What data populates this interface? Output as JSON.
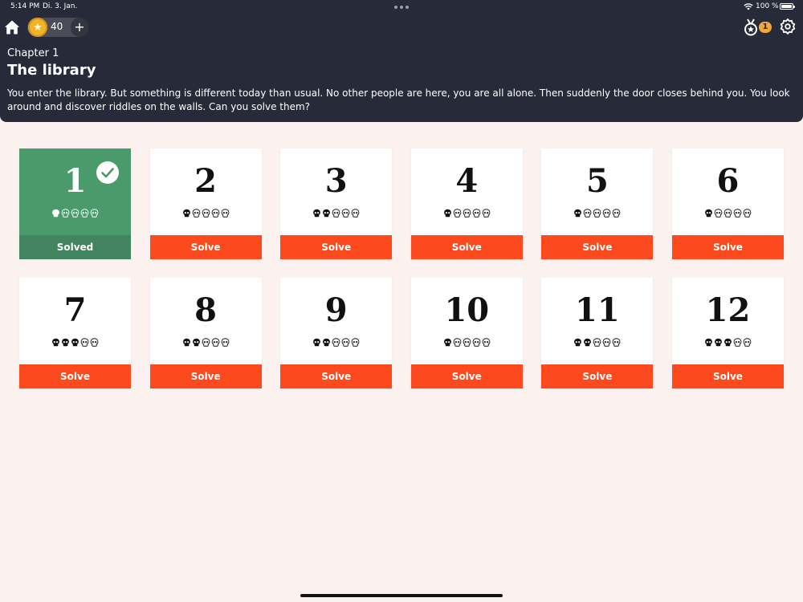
{
  "status_bar": {
    "time": "5:14 PM",
    "date": "Di. 3. Jan.",
    "battery": "100 %"
  },
  "toolbar": {
    "coins": "40",
    "add_label": "+",
    "medal_count": "1"
  },
  "chapter": {
    "label": "Chapter 1",
    "title": "The library",
    "description": "You enter the library. But something is different today than usual. No other people are here, you are all alone. Then suddenly the door closes behind you. You look around and discover riddles on the walls. Can you solve them?"
  },
  "riddles": [
    {
      "number": "1",
      "difficulty": 1,
      "status": "Solved",
      "solved": true
    },
    {
      "number": "2",
      "difficulty": 1,
      "status": "Solve",
      "solved": false
    },
    {
      "number": "3",
      "difficulty": 2,
      "status": "Solve",
      "solved": false
    },
    {
      "number": "4",
      "difficulty": 1,
      "status": "Solve",
      "solved": false
    },
    {
      "number": "5",
      "difficulty": 1,
      "status": "Solve",
      "solved": false
    },
    {
      "number": "6",
      "difficulty": 1,
      "status": "Solve",
      "solved": false
    },
    {
      "number": "7",
      "difficulty": 3,
      "status": "Solve",
      "solved": false
    },
    {
      "number": "8",
      "difficulty": 2,
      "status": "Solve",
      "solved": false
    },
    {
      "number": "9",
      "difficulty": 2,
      "status": "Solve",
      "solved": false
    },
    {
      "number": "10",
      "difficulty": 1,
      "status": "Solve",
      "solved": false
    },
    {
      "number": "11",
      "difficulty": 2,
      "status": "Solve",
      "solved": false
    },
    {
      "number": "12",
      "difficulty": 3,
      "status": "Solve",
      "solved": false
    }
  ],
  "difficulty_max": 5,
  "colors": {
    "header_bg": "#272a38",
    "page_bg": "#fbf1ef",
    "solve_button": "#fc4a1e",
    "solved_card": "#4a9a6b",
    "solved_bar": "#438460",
    "coin": "#f0b429"
  }
}
